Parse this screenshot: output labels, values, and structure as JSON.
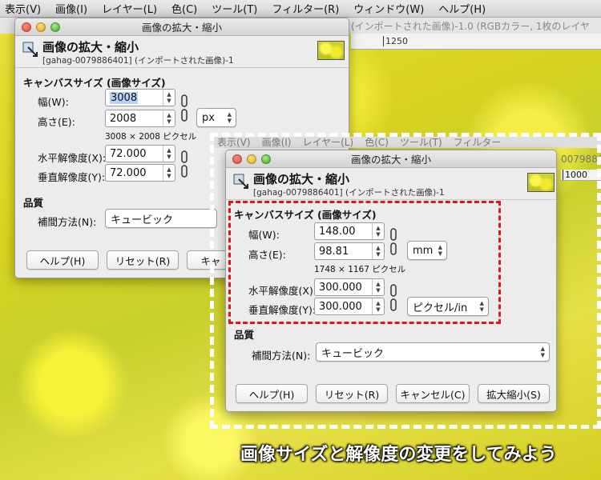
{
  "back_window": {
    "menu": [
      "表示(V)",
      "画像(I)",
      "レイヤー(L)",
      "色(C)",
      "ツール(T)",
      "フィルター(R)",
      "ウィンドウ(W)",
      "ヘルプ(H)"
    ],
    "title": "(インポートされた画像)-1.0 (RGBカラー, 1枚のレイヤ",
    "ruler_mark": "1250"
  },
  "dialog_back": {
    "title": "画像の拡大・縮小",
    "heading": "画像の拡大・縮小",
    "subheading": "[gahag-0079886401] (インポートされた画像)-1",
    "canvas_section": "キャンバスサイズ (画像サイズ)",
    "width_label": "幅(W):",
    "width_value": "3008",
    "height_label": "高さ(E):",
    "height_value": "2008",
    "unit": "px",
    "pixel_note": "3008 × 2008 ピクセル",
    "xres_label": "水平解像度(X):",
    "xres_value": "72.000",
    "yres_label": "垂直解像度(Y):",
    "yres_value": "72.000",
    "quality_section": "品質",
    "interp_label": "補間方法(N):",
    "interp_value": "キュービック",
    "btn_help": "ヘルプ(H)",
    "btn_reset": "リセット(R)",
    "btn_cancel_partial": "キャ"
  },
  "front_menubar": [
    "表示(V)",
    "画像(I)",
    "レイヤー(L)",
    "色(C)",
    "ツール(T)",
    "フィルター"
  ],
  "front_ruler": "1000",
  "front_title_partial": "0079886",
  "dialog_front": {
    "title": "画像の拡大・縮小",
    "heading": "画像の拡大・縮小",
    "subheading": "[gahag-0079886401] (インポートされた画像)-1",
    "canvas_section": "キャンバスサイズ (画像サイズ)",
    "width_label": "幅(W):",
    "width_value": "148.00",
    "height_label": "高さ(E):",
    "height_value": "98.81",
    "unit": "mm",
    "pixel_note": "1748 × 1167 ピクセル",
    "xres_label": "水平解像度(X):",
    "xres_value": "300.000",
    "yres_label": "垂直解像度(Y):",
    "yres_value": "300.000",
    "res_unit": "ピクセル/in",
    "quality_section": "品質",
    "interp_label": "補間方法(N):",
    "interp_value": "キュービック",
    "btn_help": "ヘルプ(H)",
    "btn_reset": "リセット(R)",
    "btn_cancel": "キャンセル(C)",
    "btn_scale": "拡大縮小(S)"
  },
  "caption": "画像サイズと解像度の変更をしてみよう",
  "colors": {
    "highlight_box": "#e4141b",
    "frame": "#ffffff"
  }
}
